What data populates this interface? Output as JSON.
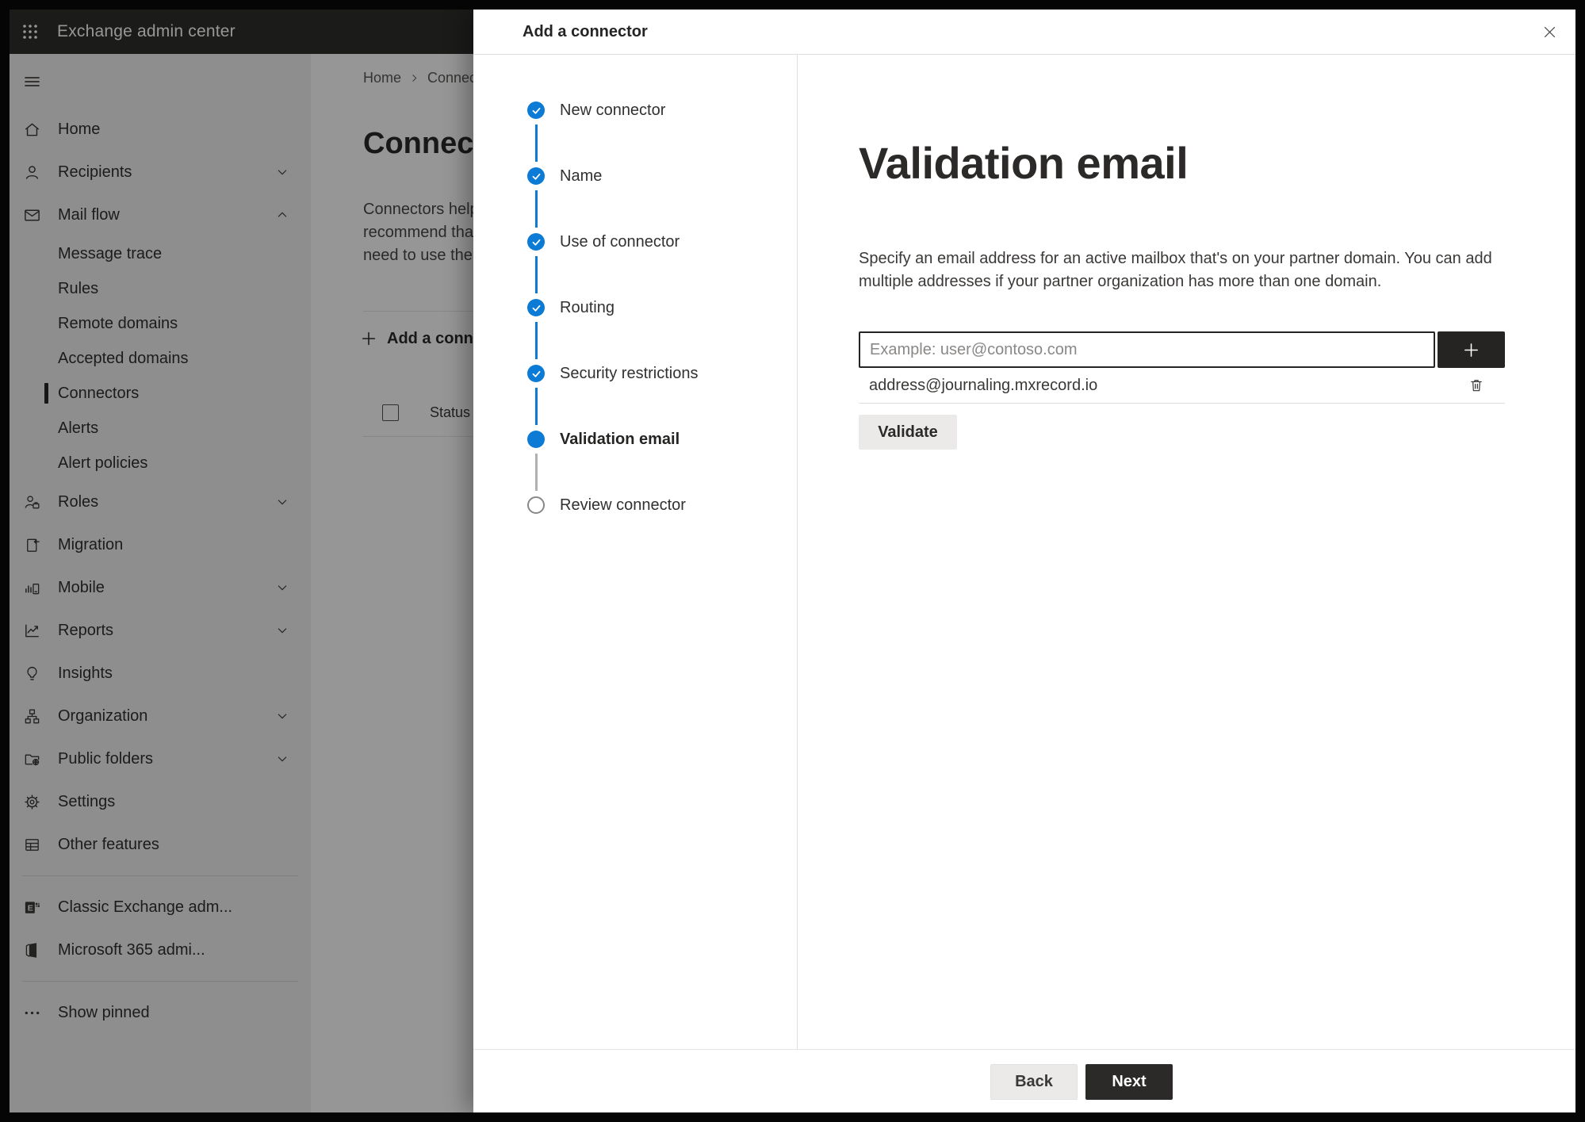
{
  "topbar": {
    "app_title": "Exchange admin center"
  },
  "sidebar": {
    "items": [
      {
        "label": "Home",
        "icon": "home-icon"
      },
      {
        "label": "Recipients",
        "icon": "person-icon",
        "chevron": "down"
      },
      {
        "label": "Mail flow",
        "icon": "mail-icon",
        "chevron": "up",
        "expanded": true
      },
      {
        "label": "Message trace",
        "type": "sub"
      },
      {
        "label": "Rules",
        "type": "sub"
      },
      {
        "label": "Remote domains",
        "type": "sub"
      },
      {
        "label": "Accepted domains",
        "type": "sub"
      },
      {
        "label": "Connectors",
        "type": "sub",
        "selected": true
      },
      {
        "label": "Alerts",
        "type": "sub"
      },
      {
        "label": "Alert policies",
        "type": "sub"
      },
      {
        "label": "Roles",
        "icon": "roles-icon",
        "chevron": "down"
      },
      {
        "label": "Migration",
        "icon": "migration-icon"
      },
      {
        "label": "Mobile",
        "icon": "mobile-icon",
        "chevron": "down"
      },
      {
        "label": "Reports",
        "icon": "reports-icon",
        "chevron": "down"
      },
      {
        "label": "Insights",
        "icon": "insights-icon"
      },
      {
        "label": "Organization",
        "icon": "organization-icon",
        "chevron": "down"
      },
      {
        "label": "Public folders",
        "icon": "public-folders-icon",
        "chevron": "down"
      },
      {
        "label": "Settings",
        "icon": "settings-icon"
      },
      {
        "label": "Other features",
        "icon": "other-features-icon"
      },
      {
        "label": "Classic Exchange adm...",
        "icon": "classic-exchange-icon"
      },
      {
        "label": "Microsoft 365 admi...",
        "icon": "microsoft-365-icon"
      },
      {
        "label": "Show pinned",
        "icon": "ellipsis-icon"
      }
    ]
  },
  "page": {
    "breadcrumb": {
      "home": "Home",
      "current": "Connectors"
    },
    "title": "Connectors",
    "desc_line1": "Connectors help",
    "desc_line2": "recommend that",
    "desc_line3": "need to use them",
    "add_button_label": "Add a connector",
    "table": {
      "status_column": "Status"
    }
  },
  "dialog": {
    "title": "Add a connector",
    "steps": [
      {
        "label": "New connector",
        "state": "completed"
      },
      {
        "label": "Name",
        "state": "completed"
      },
      {
        "label": "Use of connector",
        "state": "completed"
      },
      {
        "label": "Routing",
        "state": "completed"
      },
      {
        "label": "Security restrictions",
        "state": "completed"
      },
      {
        "label": "Validation email",
        "state": "current"
      },
      {
        "label": "Review connector",
        "state": "upcoming"
      }
    ],
    "content": {
      "heading": "Validation email",
      "description": "Specify an email address for an active mailbox that's on your partner domain. You can add multiple addresses if your partner organization has more than one domain.",
      "email_input": {
        "value": "",
        "placeholder": "Example: user@contoso.com"
      },
      "addresses": [
        "address@journaling.mxrecord.io"
      ],
      "validate_label": "Validate"
    },
    "footer": {
      "back_label": "Back",
      "next_label": "Next"
    }
  },
  "colors": {
    "accent": "#0b7bd6",
    "topbar_bg": "#2f2e2d",
    "primary_button": "#2b2a29",
    "selected_indicator": "#2b2826"
  }
}
